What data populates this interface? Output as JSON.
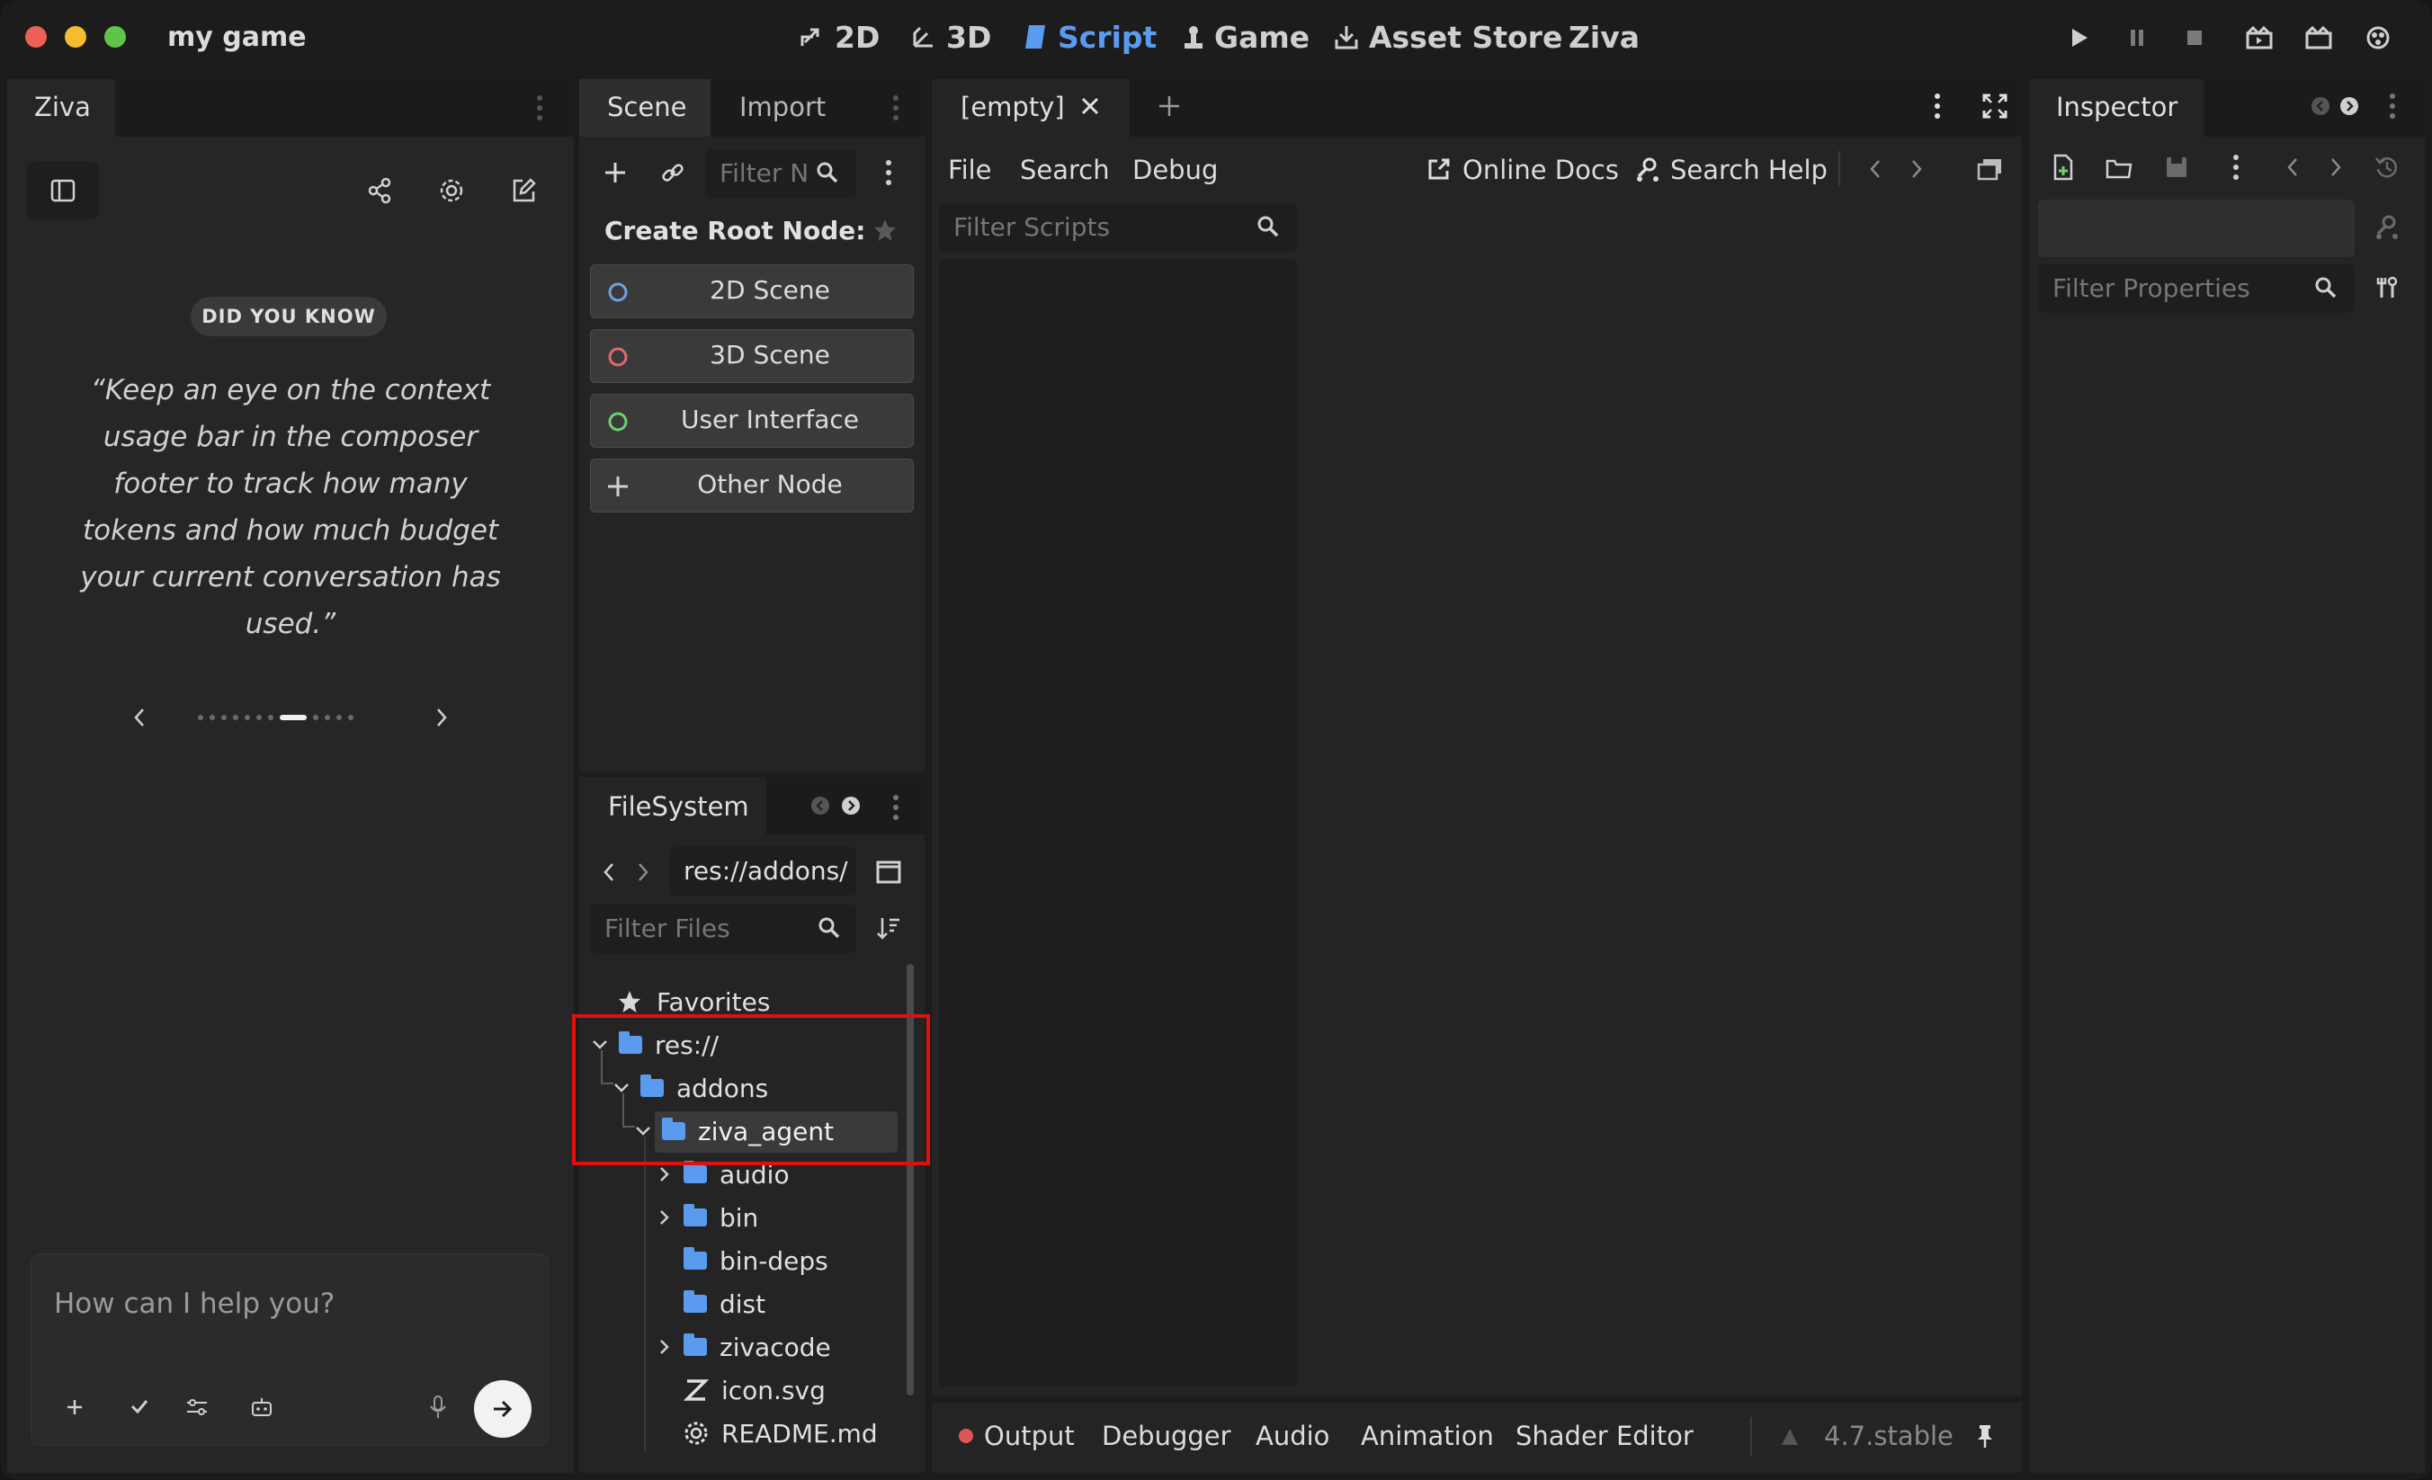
{
  "window": {
    "title": "my game"
  },
  "top_tabs": [
    "2D",
    "3D",
    "Script",
    "Game",
    "Asset Store",
    "Ziva"
  ],
  "ziva_panel": {
    "tab": "Ziva",
    "did_you_know": "DID YOU KNOW",
    "tip": "“Keep an eye on the context usage bar in the composer footer to track how many tokens and how much budget your current conversation has used.”",
    "tip_lines": [
      "“Keep an eye on the context",
      "usage bar in the composer",
      "footer to track how many",
      "tokens and how much budget",
      "your current conversation has",
      "used.”"
    ],
    "pagination": {
      "total": 12,
      "active": 8
    },
    "composer_placeholder": "How can I help you?"
  },
  "scene_panel": {
    "tabs": [
      "Scene",
      "Import"
    ],
    "filter_placeholder": "Filter N",
    "create_root_label": "Create Root Node:",
    "root_buttons": [
      {
        "label": "2D Scene",
        "color": "#6f9fe0"
      },
      {
        "label": "3D Scene",
        "color": "#e06a6a"
      },
      {
        "label": "User Interface",
        "color": "#6ed06e"
      },
      {
        "label": "Other Node",
        "color": "#d0d0d0"
      }
    ]
  },
  "filesystem": {
    "tab": "FileSystem",
    "path": "res://addons/",
    "filter_placeholder": "Filter Files",
    "favorites": "Favorites",
    "tree": [
      {
        "label": "res://",
        "type": "folder",
        "depth": 0,
        "expanded": true
      },
      {
        "label": "addons",
        "type": "folder",
        "depth": 1,
        "expanded": true
      },
      {
        "label": "ziva_agent",
        "type": "folder",
        "depth": 2,
        "expanded": true,
        "selected": true
      },
      {
        "label": "audio",
        "type": "folder",
        "depth": 3,
        "collapsed": true
      },
      {
        "label": "bin",
        "type": "folder",
        "depth": 3,
        "collapsed": true
      },
      {
        "label": "bin-deps",
        "type": "folder",
        "depth": 3
      },
      {
        "label": "dist",
        "type": "folder",
        "depth": 3
      },
      {
        "label": "zivacode",
        "type": "folder",
        "depth": 3,
        "collapsed": true
      },
      {
        "label": "icon.svg",
        "type": "svg",
        "depth": 3
      },
      {
        "label": "README.md",
        "type": "md",
        "depth": 3
      }
    ]
  },
  "script_editor": {
    "tab": "[empty]",
    "menu": [
      "File",
      "Search",
      "Debug"
    ],
    "online_docs": "Online Docs",
    "search_help": "Search Help",
    "filter_scripts_placeholder": "Filter Scripts"
  },
  "bottom_panel": {
    "tabs": [
      "Output",
      "Debugger",
      "Audio",
      "Animation",
      "Shader Editor"
    ],
    "version": "4.7.stable"
  },
  "inspector": {
    "tab": "Inspector",
    "filter_placeholder": "Filter Properties"
  },
  "colors": {
    "accent": "#5a9bf0",
    "highlight_box": "#e01010",
    "output_dot": "#e05555"
  }
}
